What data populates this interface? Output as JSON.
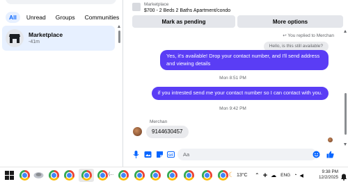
{
  "filters": [
    {
      "label": "All",
      "active": true
    },
    {
      "label": "Unread",
      "active": false
    },
    {
      "label": "Groups",
      "active": false
    },
    {
      "label": "Communities",
      "active": false
    }
  ],
  "conversation": {
    "name": "Marketplace",
    "subtitle": "-41m"
  },
  "header": {
    "title": "Marketplace",
    "listing": "$700 - 2 Beds 2 Baths Apartment/condo",
    "pending_label": "Mark as pending",
    "more_label": "More options"
  },
  "messages": {
    "replied_label": "You replied to Merchan",
    "quoted": "Hello, is this still available?",
    "out1": "Yes, it's available! Drop your contact number, and I'll send address and viewing details",
    "time1": "Mon 8:51 PM",
    "out2": "if you intrested send me your contact number so I can contact with you.",
    "time2": "Mon 9:42 PM",
    "sender": "Merchan",
    "in1": "9144630457"
  },
  "composer": {
    "placeholder": "Aa"
  },
  "taskbar": {
    "temperature": "13°C",
    "language": "ENG",
    "time": "9:38 PM",
    "date": "12/2/2025",
    "tab_label": "(..."
  },
  "colors": {
    "accent": "#0866ff",
    "bubble": "#5a3df5"
  }
}
